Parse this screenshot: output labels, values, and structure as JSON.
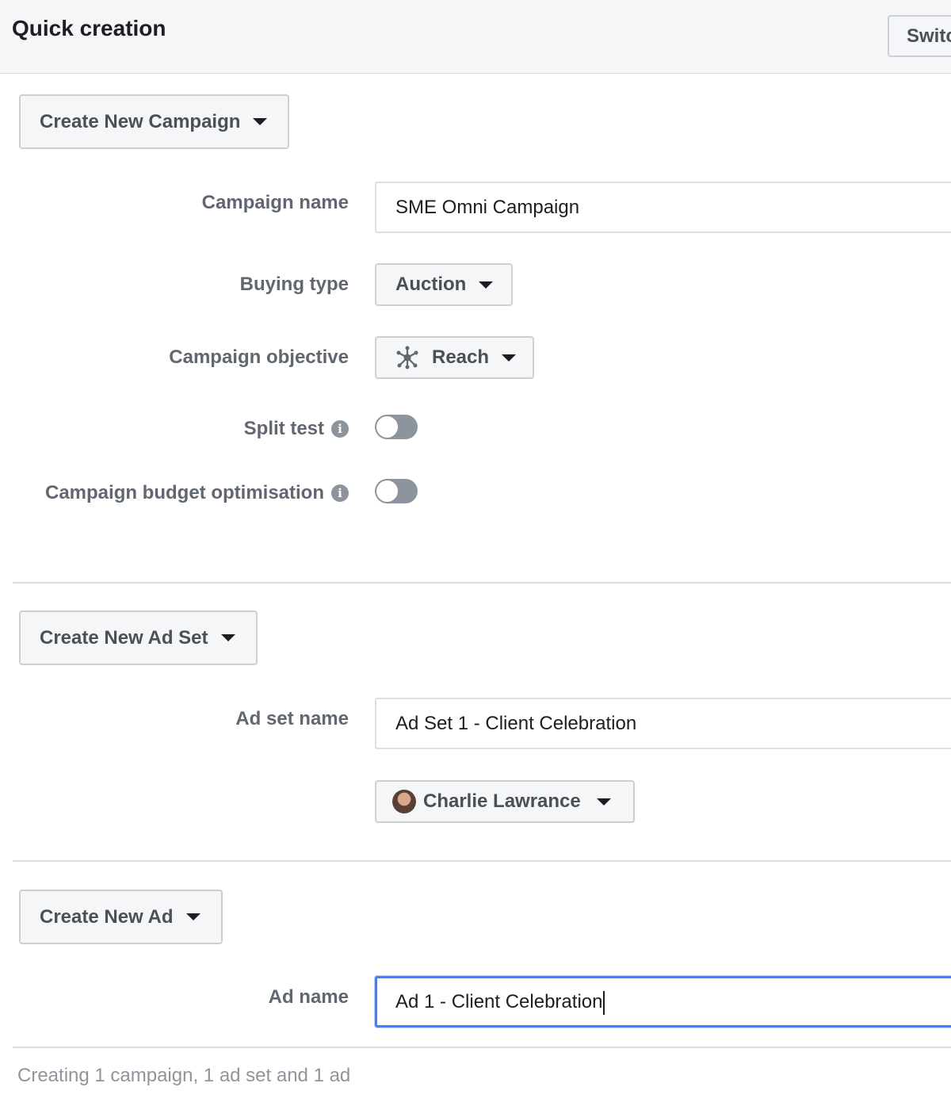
{
  "header": {
    "title": "Quick creation",
    "switch_label": "Switch"
  },
  "campaign": {
    "create_button_label": "Create New Campaign",
    "name_label": "Campaign name",
    "name_value": "SME Omni Campaign",
    "buying_type_label": "Buying type",
    "buying_type_value": "Auction",
    "objective_label": "Campaign objective",
    "objective_value": "Reach",
    "objective_icon": "reach-icon",
    "split_test_label": "Split test",
    "split_test_enabled": false,
    "budget_opt_label": "Campaign budget optimisation",
    "budget_opt_enabled": false
  },
  "ad_set": {
    "create_button_label": "Create New Ad Set",
    "name_label": "Ad set name",
    "name_value": "Ad Set 1 - Client Celebration",
    "page_value": "Charlie Lawrance"
  },
  "ad": {
    "create_button_label": "Create New Ad",
    "name_label": "Ad name",
    "name_value": "Ad 1 - Client Celebration"
  },
  "footer": {
    "summary": "Creating 1 campaign, 1 ad set and 1 ad"
  },
  "colors": {
    "focus_border": "#4080ff",
    "toggle_off": "#8d949e",
    "header_bg": "#f5f6f7"
  }
}
